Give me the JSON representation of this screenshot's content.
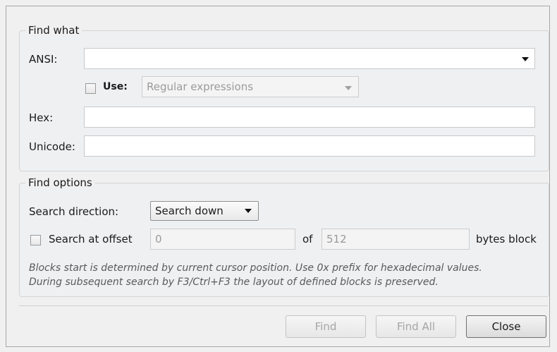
{
  "find_what": {
    "title": "Find what",
    "ansi_label": "ANSI:",
    "ansi_value": "",
    "use_label": "Use:",
    "use_checked": false,
    "use_option": "Regular expressions",
    "hex_label": "Hex:",
    "hex_value": "",
    "unicode_label": "Unicode:",
    "unicode_value": ""
  },
  "find_options": {
    "title": "Find options",
    "direction_label": "Search direction:",
    "direction_value": "Search down",
    "offset_label": "Search at offset",
    "offset_checked": false,
    "offset_value": "0",
    "of_label": "of",
    "block_value": "512",
    "bytes_label": "bytes block",
    "note_line1": "Blocks start is determined by current cursor position. Use 0x prefix for hexadecimal values.",
    "note_line2": "During subsequent search by F3/Ctrl+F3 the layout of defined blocks is preserved."
  },
  "buttons": {
    "find": "Find",
    "find_all": "Find All",
    "close": "Close"
  }
}
